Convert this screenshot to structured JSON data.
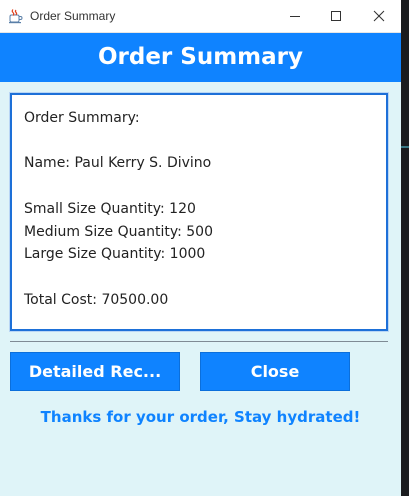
{
  "window": {
    "title": "Order Summary",
    "icon": "java-cup-icon"
  },
  "window_controls": {
    "minimize_icon": "minimize-icon",
    "maximize_icon": "maximize-icon",
    "close_icon": "close-icon"
  },
  "header": {
    "title": "Order Summary",
    "background_color": "#0f83ff"
  },
  "summary": {
    "text": "Order Summary:\n\nName: Paul Kerry S. Divino\n\nSmall Size Quantity: 120\nMedium Size Quantity: 500\nLarge Size Quantity: 1000\n\nTotal Cost: 70500.00"
  },
  "buttons": {
    "detailed_label": "Detailed Rec...",
    "close_label": "Close",
    "color": "#0f83ff"
  },
  "footer": {
    "message": "Thanks for your order, Stay hydrated!"
  },
  "colors": {
    "window_background": "#dff4f8",
    "accent": "#0f83ff",
    "box_border": "#1d70d8"
  }
}
